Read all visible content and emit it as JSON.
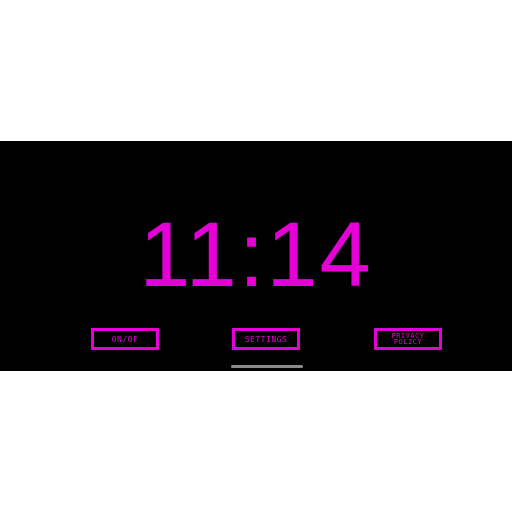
{
  "clock": {
    "time": "11:14"
  },
  "buttons": {
    "onoff": "ON/OF",
    "settings": "SETTINGS",
    "privacy_line1": "PRIVACY",
    "privacy_line2": "POLICY"
  },
  "colors": {
    "accent": "#e600d8",
    "background": "#000000",
    "outer": "#ffffff"
  }
}
